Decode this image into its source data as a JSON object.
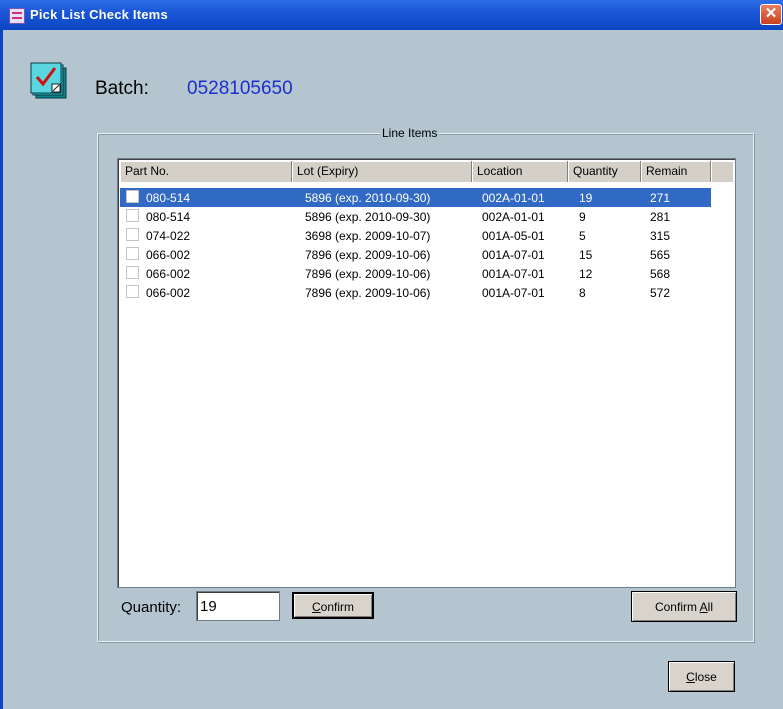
{
  "window": {
    "title": "Pick List Check Items",
    "close_glyph": "✕",
    "app_icon": "picklist-icon"
  },
  "batch": {
    "label": "Batch:",
    "value": "0528105650",
    "icon": "checklist-icon"
  },
  "line_items": {
    "group_label": "Line Items",
    "columns": [
      "Part No.",
      "Lot (Expiry)",
      "Location",
      "Quantity",
      "Remain"
    ],
    "rows": [
      {
        "part_no": "080-514",
        "lot": "5896 (exp. 2010-09-30)",
        "location": "002A-01-01",
        "quantity": "19",
        "remain": "271",
        "selected": true,
        "checked": false
      },
      {
        "part_no": "080-514",
        "lot": "5896 (exp. 2010-09-30)",
        "location": "002A-01-01",
        "quantity": "9",
        "remain": "281",
        "selected": false,
        "checked": false
      },
      {
        "part_no": "074-022",
        "lot": "3698 (exp. 2009-10-07)",
        "location": "001A-05-01",
        "quantity": "5",
        "remain": "315",
        "selected": false,
        "checked": false
      },
      {
        "part_no": "066-002",
        "lot": "7896 (exp. 2009-10-06)",
        "location": "001A-07-01",
        "quantity": "15",
        "remain": "565",
        "selected": false,
        "checked": false
      },
      {
        "part_no": "066-002",
        "lot": "7896 (exp. 2009-10-06)",
        "location": "001A-07-01",
        "quantity": "12",
        "remain": "568",
        "selected": false,
        "checked": false
      },
      {
        "part_no": "066-002",
        "lot": "7896 (exp. 2009-10-06)",
        "location": "001A-07-01",
        "quantity": "8",
        "remain": "572",
        "selected": false,
        "checked": false
      }
    ]
  },
  "quantity": {
    "label": "Quantity:",
    "value": "19"
  },
  "buttons": {
    "confirm": {
      "accel": "C",
      "rest": "onfirm"
    },
    "confirm_all": {
      "pre": "Confirm ",
      "accel": "A",
      "rest": "ll"
    },
    "close": {
      "accel": "C",
      "rest": "lose"
    }
  },
  "colors": {
    "titlebar": "#0b45c4",
    "dialog_bg": "#b4c5d0",
    "batch_value": "#1c2ed3",
    "selection": "#316ac5"
  }
}
